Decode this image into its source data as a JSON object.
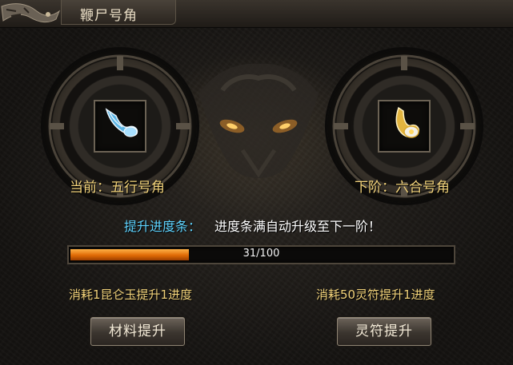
{
  "window": {
    "title": "鞭尸号角"
  },
  "current": {
    "label": "当前：五行号角",
    "icon": "blue-horn-icon"
  },
  "next": {
    "label": "下阶：六合号角",
    "icon": "gold-horn-icon"
  },
  "progress": {
    "label": "提升进度条：",
    "description": "进度条满自动升级至下一阶！",
    "text": "31/100",
    "value": 31,
    "max": 100
  },
  "upgrade": {
    "material_cost": "消耗1昆仑玉提升1进度",
    "material_button": "材料提升",
    "talisman_cost": "消耗50灵符提升1进度",
    "talisman_button": "灵符提升"
  },
  "colors": {
    "label_gold": "#f1d27a",
    "label_cyan": "#5fd4ff",
    "progress_orange": "#e06a05"
  }
}
